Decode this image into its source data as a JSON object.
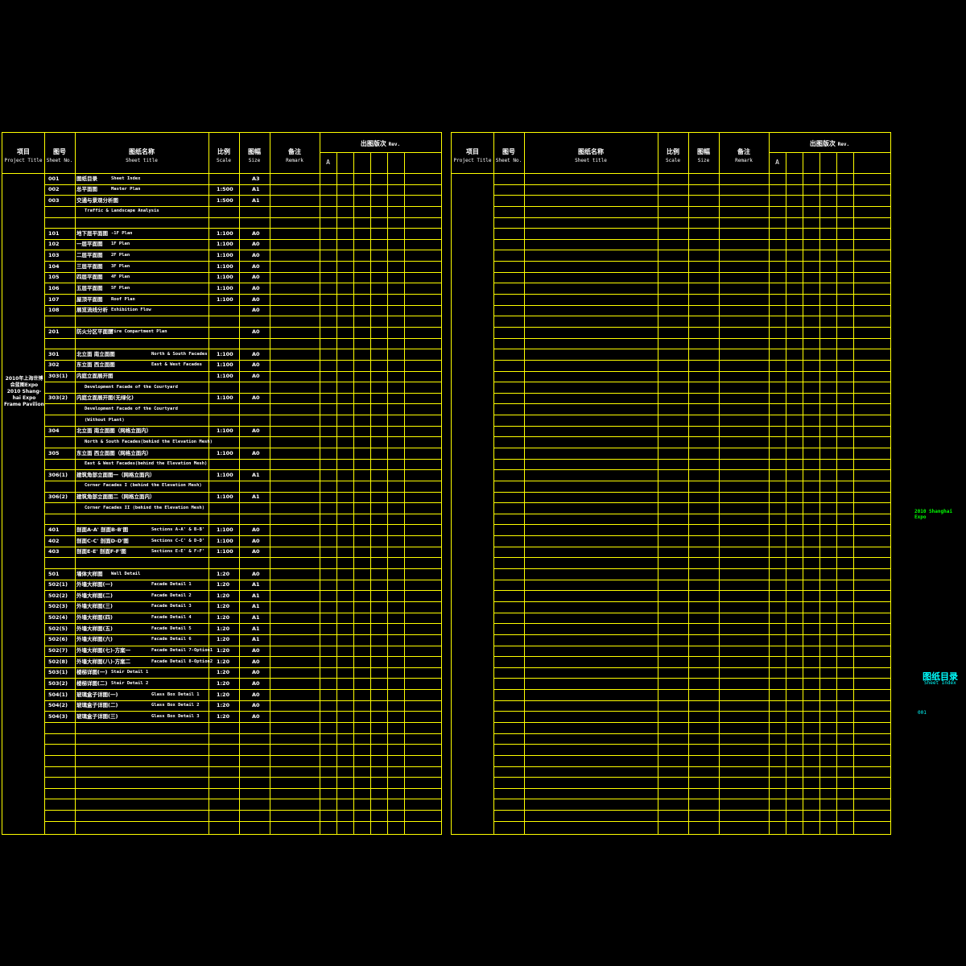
{
  "header": {
    "project_cn": "项目",
    "project_en": "Project Title",
    "sheetno_cn": "图号",
    "sheetno_en": "Sheet No.",
    "title_cn": "图纸名称",
    "title_en": "Sheet title",
    "scale_cn": "比例",
    "scale_en": "Scale",
    "size_cn": "图幅",
    "size_en": "Size",
    "remark_cn": "备注",
    "remark_en": "Remark",
    "rev_cn": "出图版次",
    "rev_en": "Rev.",
    "rev_a": "A"
  },
  "project_title": "2010年上海世博会蓝图Expo 2010 Shang-hai Expo Frame Pavilion",
  "rows": [
    {
      "no": "001",
      "cn": "图纸目录",
      "en": "Sheet Index",
      "scale": "",
      "size": "A3"
    },
    {
      "no": "002",
      "cn": "总平面图",
      "en": "Master Plan",
      "scale": "1:500",
      "size": "A1"
    },
    {
      "no": "003",
      "cn": "交通与景观分析图",
      "en": "",
      "scale": "1:500",
      "size": "A1"
    },
    {
      "no": "",
      "cn": "",
      "en": "Traffic & Landscape Analysis",
      "scale": "",
      "size": ""
    },
    {
      "no": "",
      "cn": "",
      "en": "",
      "scale": "",
      "size": ""
    },
    {
      "no": "101",
      "cn": "地下层平面图",
      "en": "-1F Plan",
      "scale": "1:100",
      "size": "A0"
    },
    {
      "no": "102",
      "cn": "一层平面图",
      "en": "1F Plan",
      "scale": "1:100",
      "size": "A0"
    },
    {
      "no": "103",
      "cn": "二层平面图",
      "en": "2F Plan",
      "scale": "1:100",
      "size": "A0"
    },
    {
      "no": "104",
      "cn": "三层平面图",
      "en": "3F Plan",
      "scale": "1:100",
      "size": "A0"
    },
    {
      "no": "105",
      "cn": "四层平面图",
      "en": "4F Plan",
      "scale": "1:100",
      "size": "A0"
    },
    {
      "no": "106",
      "cn": "五层平面图",
      "en": "5F Plan",
      "scale": "1:100",
      "size": "A0"
    },
    {
      "no": "107",
      "cn": "屋顶平面图",
      "en": "Roof Plan",
      "scale": "1:100",
      "size": "A0"
    },
    {
      "no": "108",
      "cn": "展览流线分析",
      "en": "Exhibition Flow",
      "scale": "",
      "size": "A0"
    },
    {
      "no": "",
      "cn": "",
      "en": "",
      "scale": "",
      "size": ""
    },
    {
      "no": "201",
      "cn": "防火分区平面图",
      "en": "Fire Compartment Plan",
      "scale": "",
      "size": "A0"
    },
    {
      "no": "",
      "cn": "",
      "en": "",
      "scale": "",
      "size": ""
    },
    {
      "no": "301",
      "cn": "北立面 南立面图",
      "en": "North & South Facades",
      "scale": "1:100",
      "size": "A0"
    },
    {
      "no": "302",
      "cn": "东立面 西立面图",
      "en": "East & West Facades",
      "scale": "1:100",
      "size": "A0"
    },
    {
      "no": "303(1)",
      "cn": "内庭立面展开图",
      "en": "",
      "scale": "1:100",
      "size": "A0"
    },
    {
      "no": "",
      "cn": "",
      "en": "Development Facade of the Courtyard",
      "scale": "",
      "size": ""
    },
    {
      "no": "303(2)",
      "cn": "内庭立面展开图(无绿化)",
      "en": "",
      "scale": "1:100",
      "size": "A0"
    },
    {
      "no": "",
      "cn": "",
      "en": "Development Facade of the Courtyard",
      "scale": "",
      "size": ""
    },
    {
      "no": "",
      "cn": "",
      "en": "(Without Plant)",
      "scale": "",
      "size": ""
    },
    {
      "no": "304",
      "cn": "北立面 南立面图（网格立面内）",
      "en": "",
      "scale": "1:100",
      "size": "A0"
    },
    {
      "no": "",
      "cn": "",
      "en": "North & South Facades(behind the Elevation Mesh)",
      "scale": "",
      "size": ""
    },
    {
      "no": "305",
      "cn": "东立面 西立面图（网格立面内）",
      "en": "",
      "scale": "1:100",
      "size": "A0"
    },
    {
      "no": "",
      "cn": "",
      "en": "East & West Facades(behind the Elevation Mesh)",
      "scale": "",
      "size": ""
    },
    {
      "no": "306(1)",
      "cn": "建筑角部立面图一（网格立面内）",
      "en": "",
      "scale": "1:100",
      "size": "A1"
    },
    {
      "no": "",
      "cn": "",
      "en": "Corner Facades I (behind the Elevation Mesh)",
      "scale": "",
      "size": ""
    },
    {
      "no": "306(2)",
      "cn": "建筑角部立面图二（网格立面内）",
      "en": "",
      "scale": "1:100",
      "size": "A1"
    },
    {
      "no": "",
      "cn": "",
      "en": "Corner Facades II (behind the Elevation Mesh)",
      "scale": "",
      "size": ""
    },
    {
      "no": "",
      "cn": "",
      "en": "",
      "scale": "",
      "size": ""
    },
    {
      "no": "401",
      "cn": "剖面A-A' 剖面B-B'图",
      "en": "Sections A-A' & B-B'",
      "scale": "1:100",
      "size": "A0"
    },
    {
      "no": "402",
      "cn": "剖面C-C' 剖面D-D'图",
      "en": "Sections C-C' & D-D'",
      "scale": "1:100",
      "size": "A0"
    },
    {
      "no": "403",
      "cn": "剖面E-E' 剖面F-F'图",
      "en": "Sections E-E' & F-F'",
      "scale": "1:100",
      "size": "A0"
    },
    {
      "no": "",
      "cn": "",
      "en": "",
      "scale": "",
      "size": ""
    },
    {
      "no": "501",
      "cn": "墙体大样图",
      "en": "Wall Detail",
      "scale": "1:20",
      "size": "A0"
    },
    {
      "no": "502(1)",
      "cn": "外墙大样图(一)",
      "en": "Facade Detail 1",
      "scale": "1:20",
      "size": "A1"
    },
    {
      "no": "502(2)",
      "cn": "外墙大样图(二)",
      "en": "Facade Detail 2",
      "scale": "1:20",
      "size": "A1"
    },
    {
      "no": "502(3)",
      "cn": "外墙大样图(三)",
      "en": "Facade Detail 3",
      "scale": "1:20",
      "size": "A1"
    },
    {
      "no": "502(4)",
      "cn": "外墙大样图(四)",
      "en": "Facade Detail 4",
      "scale": "1:20",
      "size": "A1"
    },
    {
      "no": "502(5)",
      "cn": "外墙大样图(五)",
      "en": "Facade Detail 5",
      "scale": "1:20",
      "size": "A1"
    },
    {
      "no": "502(6)",
      "cn": "外墙大样图(六)",
      "en": "Facade Detail 6",
      "scale": "1:20",
      "size": "A1"
    },
    {
      "no": "502(7)",
      "cn": "外墙大样图(七)-方案一",
      "en": "Facade Detail 7-Option1",
      "scale": "1:20",
      "size": "A0"
    },
    {
      "no": "502(8)",
      "cn": "外墙大样图(八)-方案二",
      "en": "Facade Detail 8-Option2",
      "scale": "1:20",
      "size": "A0"
    },
    {
      "no": "503(1)",
      "cn": "楼梯详图(一)",
      "en": "Stair Detail 1",
      "scale": "1:20",
      "size": "A0"
    },
    {
      "no": "503(2)",
      "cn": "楼梯详图(二)",
      "en": "Stair Detail 2",
      "scale": "1:20",
      "size": "A0"
    },
    {
      "no": "504(1)",
      "cn": "玻璃盒子详图(一)",
      "en": "Glass Box Detail 1",
      "scale": "1:20",
      "size": "A0"
    },
    {
      "no": "504(2)",
      "cn": "玻璃盒子详图(二)",
      "en": "Glass Box Detail 2",
      "scale": "1:20",
      "size": "A0"
    },
    {
      "no": "504(3)",
      "cn": "玻璃盒子详图(三)",
      "en": "Glass Box Detail 3",
      "scale": "1:20",
      "size": "A0"
    }
  ],
  "side_notes": {
    "expo": "2010 Shanghai Expo",
    "index_cn": "图纸目录",
    "index_en": "Sheet Index",
    "sheet_number": "001"
  },
  "colors": {
    "grid": "#ffff00",
    "note_green": "#00ff00",
    "note_cyan": "#00ffff",
    "text": "#ffffff"
  }
}
